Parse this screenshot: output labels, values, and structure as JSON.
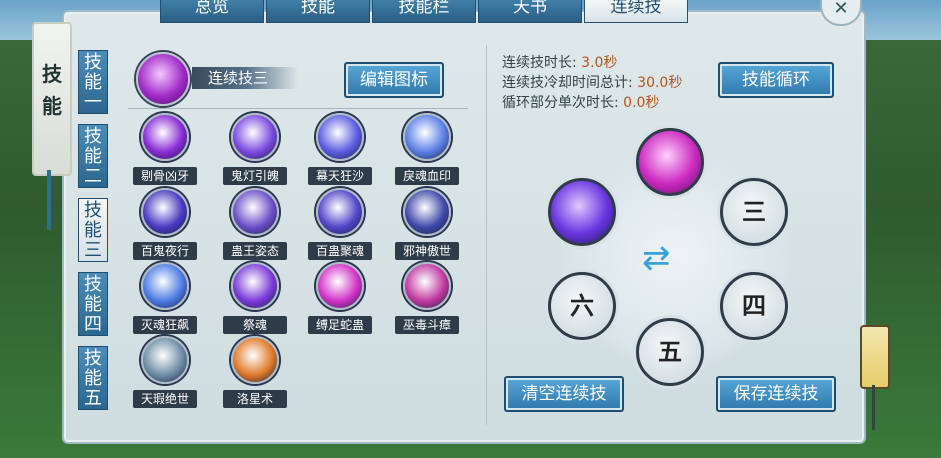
{
  "tabs": [
    "总览",
    "技能",
    "技能栏",
    "天书",
    "连续技"
  ],
  "active_tab_index": 4,
  "side_title": "技能",
  "side_tabs": [
    "技能一",
    "技能二",
    "技能三",
    "技能四",
    "技能五"
  ],
  "active_side_tab_index": 2,
  "combo": {
    "name": "连续技三",
    "edit_button": "编辑图标"
  },
  "skills": [
    {
      "name": "剔骨凶牙",
      "color": "#8a2bd6"
    },
    {
      "name": "鬼灯引魄",
      "color": "#7b4ae0"
    },
    {
      "name": "幕天狂沙",
      "color": "#5b5de0"
    },
    {
      "name": "戾魂血印",
      "color": "#5c7fe6"
    },
    {
      "name": "百鬼夜行",
      "color": "#4a3ac2"
    },
    {
      "name": "蛊王姿态",
      "color": "#6d4fc8"
    },
    {
      "name": "百蛊聚魂",
      "color": "#5346c9"
    },
    {
      "name": "邪神傲世",
      "color": "#3f4aa8"
    },
    {
      "name": "灭魂狂飙",
      "color": "#4d7ce4"
    },
    {
      "name": "祭魂",
      "color": "#7a3ad8"
    },
    {
      "name": "缚足蛇蛊",
      "color": "#d233c8"
    },
    {
      "name": "巫毒斗瘴",
      "color": "#c03aa0"
    },
    {
      "name": "天瑕绝世",
      "color": "#6e8ea6"
    },
    {
      "name": "洛星术",
      "color": "#e07a2a"
    }
  ],
  "stats": [
    {
      "label": "连续技时长:",
      "value": "3.0秒"
    },
    {
      "label": "连续技冷却时间总计:",
      "value": "30.0秒"
    },
    {
      "label": "循环部分单次时长:",
      "value": "0.0秒"
    }
  ],
  "skill_cycle_button": "技能循环",
  "slots": [
    "三",
    "四",
    "五",
    "六"
  ],
  "clear_button": "清空连续技",
  "save_button": "保存连续技"
}
